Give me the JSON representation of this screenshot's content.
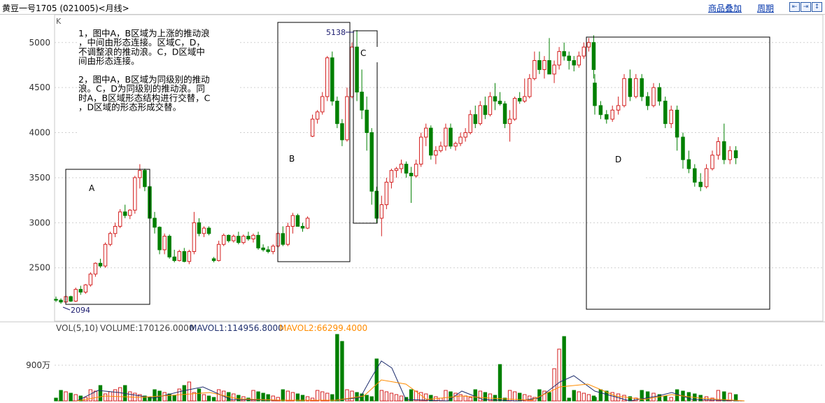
{
  "window": {
    "title": "黄豆一号1705 (021005)<月线>",
    "links": {
      "overlay": "商品叠加",
      "period": "周期"
    },
    "nav_buttons": [
      "⇤",
      "⇥",
      "↕"
    ]
  },
  "main": {
    "axis_label": "K",
    "annotation": [
      "1，图中A，B区域为上涨的推动浪",
      "，中间由形态连接。区域C，D，",
      "不调整浪的推动浪。C，D区域中",
      "间由形态连接。",
      "",
      "2，图中A，B区域为同级别的推动",
      "浪。C，D为同级别的推动浪。同",
      "时A，B区域形态结构进行交替，C",
      "，D区域的形态形成交替。"
    ],
    "region_labels": {
      "A": "A",
      "B": "B",
      "C": "C",
      "D": "D"
    },
    "peak_label": "5138",
    "low_label": "2094"
  },
  "volume": {
    "header": {
      "vol": "VOL(5,10)",
      "volume": "VOLUME:170126.0000",
      "mavol1": "MAVOL1:114956.8000",
      "mavol2": "MAVOL2:66299.4000"
    },
    "y_tick": "900万"
  },
  "colors": {
    "up": "#d42020",
    "down": "#008000",
    "mavol1": "#1f2f6e",
    "mavol2": "#ff8c00",
    "grid": "#d0d0d0"
  },
  "chart_data": {
    "type": "candlestick",
    "title": "黄豆一号1705 (021005)<月线>",
    "ylim": [
      2094,
      5138
    ],
    "y_ticks": [
      2500,
      3000,
      3500,
      4000,
      4500,
      5000
    ],
    "annotated_high": 5138,
    "annotated_low": 2094,
    "ohlc": [
      [
        2150,
        2180,
        2120,
        2140
      ],
      [
        2140,
        2160,
        2100,
        2120
      ],
      [
        2120,
        2200,
        2094,
        2180
      ],
      [
        2180,
        2190,
        2120,
        2130
      ],
      [
        2130,
        2280,
        2120,
        2260
      ],
      [
        2260,
        2300,
        2200,
        2230
      ],
      [
        2230,
        2320,
        2210,
        2310
      ],
      [
        2310,
        2450,
        2290,
        2430
      ],
      [
        2430,
        2560,
        2400,
        2550
      ],
      [
        2550,
        2600,
        2500,
        2520
      ],
      [
        2520,
        2780,
        2500,
        2760
      ],
      [
        2760,
        2900,
        2740,
        2880
      ],
      [
        2880,
        3000,
        2840,
        2960
      ],
      [
        2960,
        3150,
        2940,
        3120
      ],
      [
        3120,
        3200,
        3050,
        3080
      ],
      [
        3080,
        3150,
        3040,
        3140
      ],
      [
        3140,
        3520,
        3100,
        3500
      ],
      [
        3500,
        3650,
        3380,
        3580
      ],
      [
        3580,
        3600,
        3350,
        3400
      ],
      [
        3400,
        3420,
        3000,
        3050
      ],
      [
        3050,
        3120,
        2880,
        2950
      ],
      [
        2950,
        2960,
        2650,
        2700
      ],
      [
        2700,
        2880,
        2650,
        2850
      ],
      [
        2850,
        2870,
        2600,
        2620
      ],
      [
        2620,
        2700,
        2560,
        2580
      ],
      [
        2580,
        2700,
        2570,
        2680
      ],
      [
        2680,
        2720,
        2560,
        2570
      ],
      [
        2570,
        2700,
        2540,
        2680
      ],
      [
        2680,
        3120,
        2650,
        3000
      ],
      [
        3000,
        3050,
        2850,
        2880
      ],
      [
        2880,
        2960,
        2840,
        2940
      ],
      [
        2940,
        2960,
        2860,
        2880
      ],
      [
        2600,
        2620,
        2560,
        2580
      ],
      [
        2580,
        2800,
        2570,
        2760
      ],
      [
        2760,
        2880,
        2740,
        2860
      ],
      [
        2860,
        2870,
        2780,
        2800
      ],
      [
        2800,
        2870,
        2780,
        2850
      ],
      [
        2850,
        2900,
        2760,
        2780
      ],
      [
        2780,
        2870,
        2760,
        2850
      ],
      [
        2850,
        2900,
        2800,
        2820
      ],
      [
        2820,
        2880,
        2780,
        2860
      ],
      [
        2860,
        2900,
        2700,
        2720
      ],
      [
        2720,
        2760,
        2680,
        2700
      ],
      [
        2700,
        2740,
        2660,
        2680
      ],
      [
        2680,
        2760,
        2650,
        2740
      ],
      [
        2740,
        2900,
        2720,
        2880
      ],
      [
        2880,
        2960,
        2740,
        2760
      ],
      [
        2760,
        3000,
        2740,
        2960
      ],
      [
        2960,
        3110,
        2880,
        3080
      ],
      [
        3080,
        3100,
        2960,
        2960
      ],
      [
        2960,
        3000,
        2900,
        2940
      ],
      [
        2940,
        3070,
        2930,
        3050
      ],
      [
        3960,
        4200,
        3950,
        4150
      ],
      [
        4150,
        4250,
        4100,
        4230
      ],
      [
        4230,
        4450,
        4200,
        4400
      ],
      [
        4400,
        4850,
        4350,
        4830
      ],
      [
        4830,
        4900,
        4300,
        4350
      ],
      [
        4350,
        4400,
        4050,
        4100
      ],
      [
        4100,
        4150,
        3850,
        3920
      ],
      [
        3920,
        4500,
        3900,
        4400
      ],
      [
        4400,
        5000,
        4380,
        4950
      ],
      [
        4950,
        5138,
        4350,
        4450
      ],
      [
        4450,
        4700,
        4150,
        4250
      ],
      [
        4250,
        4400,
        3800,
        4000
      ],
      [
        4000,
        4050,
        3200,
        3350
      ],
      [
        3350,
        3400,
        3000,
        3050
      ],
      [
        3050,
        3300,
        2850,
        3200
      ],
      [
        3200,
        3500,
        3150,
        3450
      ],
      [
        3450,
        3600,
        3380,
        3580
      ],
      [
        3580,
        3620,
        3500,
        3600
      ],
      [
        3600,
        3700,
        3550,
        3650
      ],
      [
        3650,
        3680,
        3500,
        3550
      ],
      [
        3550,
        3620,
        3220,
        3520
      ],
      [
        3520,
        3700,
        3500,
        3650
      ],
      [
        3650,
        4000,
        3620,
        3950
      ],
      [
        3950,
        4100,
        3850,
        4050
      ],
      [
        4050,
        4080,
        3700,
        3750
      ],
      [
        3750,
        3850,
        3650,
        3800
      ],
      [
        3800,
        3900,
        3780,
        3850
      ],
      [
        3850,
        4100,
        3800,
        4050
      ],
      [
        4050,
        4100,
        3820,
        3850
      ],
      [
        3850,
        3900,
        3800,
        3880
      ],
      [
        3880,
        4000,
        3850,
        3950
      ],
      [
        3950,
        4050,
        3900,
        4000
      ],
      [
        4000,
        4250,
        3980,
        4200
      ],
      [
        4200,
        4300,
        4050,
        4100
      ],
      [
        4100,
        4350,
        4080,
        4300
      ],
      [
        4300,
        4400,
        4150,
        4200
      ],
      [
        4200,
        4450,
        4180,
        4400
      ],
      [
        4400,
        4550,
        4250,
        4350
      ],
      [
        4350,
        4450,
        4300,
        4320
      ],
      [
        4320,
        4350,
        4050,
        4100
      ],
      [
        4100,
        4250,
        3900,
        4150
      ],
      [
        4150,
        4400,
        4130,
        4380
      ],
      [
        4380,
        4450,
        4320,
        4350
      ],
      [
        4350,
        4600,
        4330,
        4400
      ],
      [
        4400,
        4650,
        4380,
        4600
      ],
      [
        4600,
        4900,
        4580,
        4800
      ],
      [
        4800,
        4900,
        4650,
        4700
      ],
      [
        4700,
        4850,
        4600,
        4800
      ],
      [
        4800,
        5050,
        4780,
        4650
      ],
      [
        4650,
        4800,
        4550,
        4750
      ],
      [
        4750,
        4950,
        4700,
        4900
      ],
      [
        4900,
        5000,
        4800,
        4850
      ],
      [
        4850,
        4900,
        4700,
        4800
      ],
      [
        4800,
        4850,
        4680,
        4750
      ],
      [
        4750,
        4900,
        4720,
        4850
      ],
      [
        4850,
        5000,
        4820,
        4950
      ],
      [
        4950,
        5050,
        4900,
        5000
      ],
      [
        5000,
        5080,
        4600,
        4700
      ]
    ],
    "ohlc_right": [
      [
        4550,
        4650,
        4200,
        4300
      ],
      [
        4300,
        4350,
        4150,
        4200
      ],
      [
        4200,
        4250,
        4100,
        4150
      ],
      [
        4150,
        4300,
        4120,
        4250
      ],
      [
        4250,
        4400,
        4200,
        4300
      ],
      [
        4300,
        4650,
        4280,
        4600
      ],
      [
        4600,
        4700,
        4350,
        4400
      ],
      [
        4400,
        4650,
        4380,
        4600
      ],
      [
        4600,
        4650,
        4350,
        4400
      ],
      [
        4400,
        4450,
        4250,
        4300
      ],
      [
        4300,
        4550,
        4280,
        4500
      ],
      [
        4500,
        4550,
        4300,
        4350
      ],
      [
        4350,
        4400,
        4050,
        4100
      ],
      [
        4100,
        4300,
        4050,
        4250
      ],
      [
        4250,
        4300,
        3800,
        3950
      ],
      [
        3950,
        4000,
        3600,
        3700
      ],
      [
        3700,
        3800,
        3550,
        3600
      ],
      [
        3600,
        3650,
        3400,
        3450
      ],
      [
        3450,
        3550,
        3350,
        3400
      ],
      [
        3400,
        3650,
        3380,
        3600
      ],
      [
        3600,
        3800,
        3580,
        3750
      ],
      [
        3750,
        3950,
        3700,
        3900
      ],
      [
        3900,
        4100,
        3650,
        3700
      ],
      [
        3700,
        3850,
        3650,
        3800
      ],
      [
        3800,
        3850,
        3650,
        3720
      ]
    ],
    "volume_unit": "万",
    "volume_ytick": 900
  }
}
